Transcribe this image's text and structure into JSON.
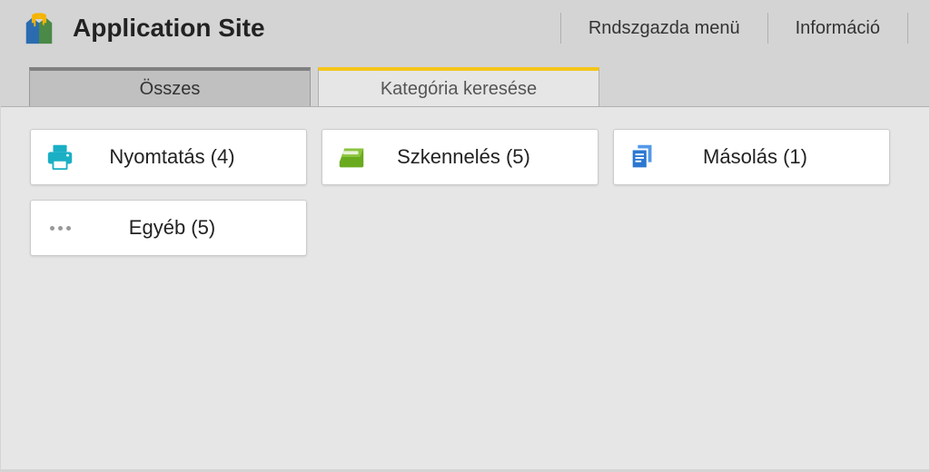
{
  "header": {
    "title": "Application Site",
    "menu": {
      "admin": "Rndszgazda menü",
      "info": "Információ"
    }
  },
  "tabs": {
    "all": "Összes",
    "search_category": "Kategória keresése"
  },
  "cards": {
    "print": "Nyomtatás (4)",
    "scan": "Szkennelés (5)",
    "copy": "Másolás (1)",
    "other": "Egyéb (5)"
  }
}
